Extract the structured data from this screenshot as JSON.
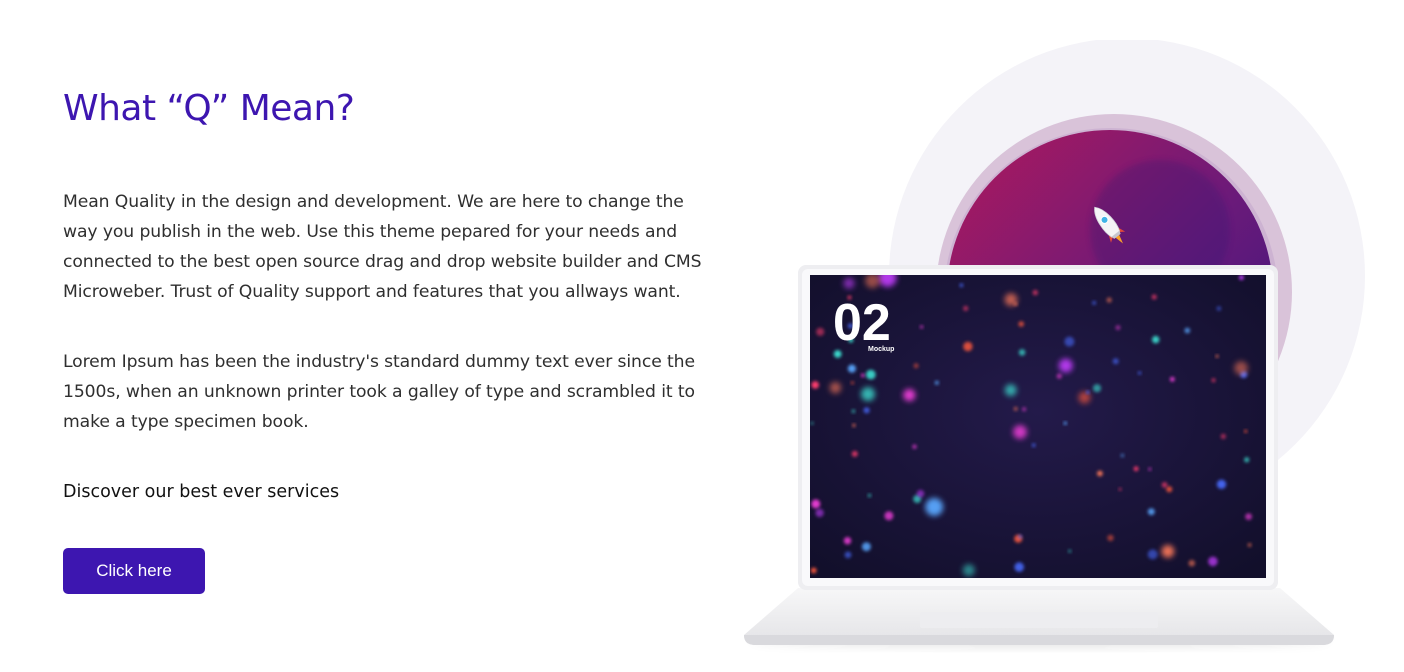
{
  "section": {
    "heading": "What “Q” Mean?",
    "paragraph_1": "Mean Quality in the design and development. We are here to change the way you publish in the web. Use this theme pepared for your needs and connected to the best open source drag and drop website builder and CMS Microweber. Trust of Quality support and features that you allways want.",
    "paragraph_2": "Lorem Ipsum has been the industry's standard dummy text ever since the 1500s, when an unknown printer took a galley of type and scrambled it to make a type specimen book.",
    "discover_text": "Discover our best ever services",
    "cta_label": "Click here"
  },
  "illustration": {
    "screen_number": "02",
    "screen_caption": "Mockup",
    "rocket_icon": "rocket-icon"
  },
  "colors": {
    "accent": "#3d16b0",
    "body_text": "#2f2f2f",
    "screen_bg": "#161233",
    "circle_magenta": "#a21b62",
    "circle_purple": "#4a1a86"
  }
}
